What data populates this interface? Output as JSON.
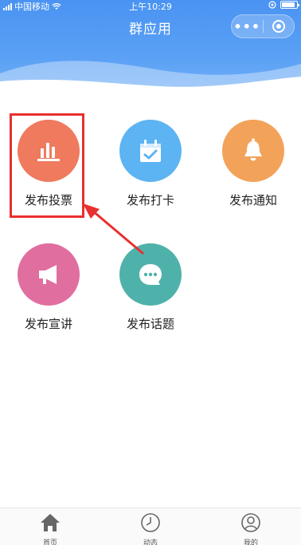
{
  "status_bar": {
    "carrier": "中国移动",
    "time": "上午10:29"
  },
  "nav": {
    "title": "群应用",
    "more": "•••"
  },
  "apps": [
    {
      "label": "发布投票",
      "icon": "bar-chart-icon",
      "color": "#ef7a5e"
    },
    {
      "label": "发布打卡",
      "icon": "calendar-check-icon",
      "color": "#5db4f2"
    },
    {
      "label": "发布通知",
      "icon": "bell-icon",
      "color": "#f3a25a"
    },
    {
      "label": "发布宣讲",
      "icon": "megaphone-icon",
      "color": "#e06e9f"
    },
    {
      "label": "发布话题",
      "icon": "chat-bubble-icon",
      "color": "#4fb2aa"
    }
  ],
  "tabbar": [
    {
      "label": "首页",
      "icon": "home-icon"
    },
    {
      "label": "动态",
      "icon": "clock-icon"
    },
    {
      "label": "我的",
      "icon": "user-icon"
    }
  ],
  "colors": {
    "header": "#4a93f2",
    "highlight": "#e8302f"
  }
}
